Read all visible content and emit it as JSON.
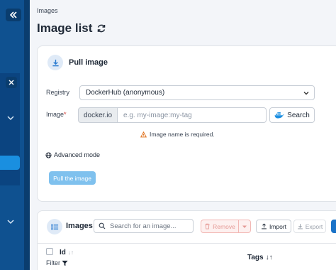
{
  "breadcrumb": "Images",
  "page_title": "Image list",
  "pull_card": {
    "title": "Pull image",
    "registry_label": "Registry",
    "registry_value": "DockerHub (anonymous)",
    "image_label": "Image",
    "required_mark": "*",
    "prefix": "docker.io",
    "image_placeholder": "e.g. my-image:my-tag",
    "search_label": "Search",
    "error_text": "Image name is required.",
    "advanced_label": "Advanced mode",
    "pull_button": "Pull the image"
  },
  "images_card": {
    "title": "Images",
    "search_placeholder": "Search for an image...",
    "remove_label": "Remove",
    "import_label": "Import",
    "export_label": "Export",
    "columns": {
      "id": "Id",
      "tags": "Tags"
    },
    "filter_label": "Filter",
    "sort_id_glyph": "↓↑",
    "sort_tags_glyph": "↓↑"
  },
  "colors": {
    "sidebar": "#0f5190",
    "accent": "#1a73c8",
    "pull_button": "#7fc1ee",
    "remove": "#e59a96",
    "warning": "#e0701b"
  },
  "icons": [
    "double-chevron-left-icon",
    "close-icon",
    "chevron-down-icon",
    "refresh-icon",
    "download-icon",
    "docker-icon",
    "warning-icon",
    "globe-icon",
    "list-icon",
    "search-icon",
    "trash-icon",
    "upload-icon",
    "filter-icon"
  ]
}
